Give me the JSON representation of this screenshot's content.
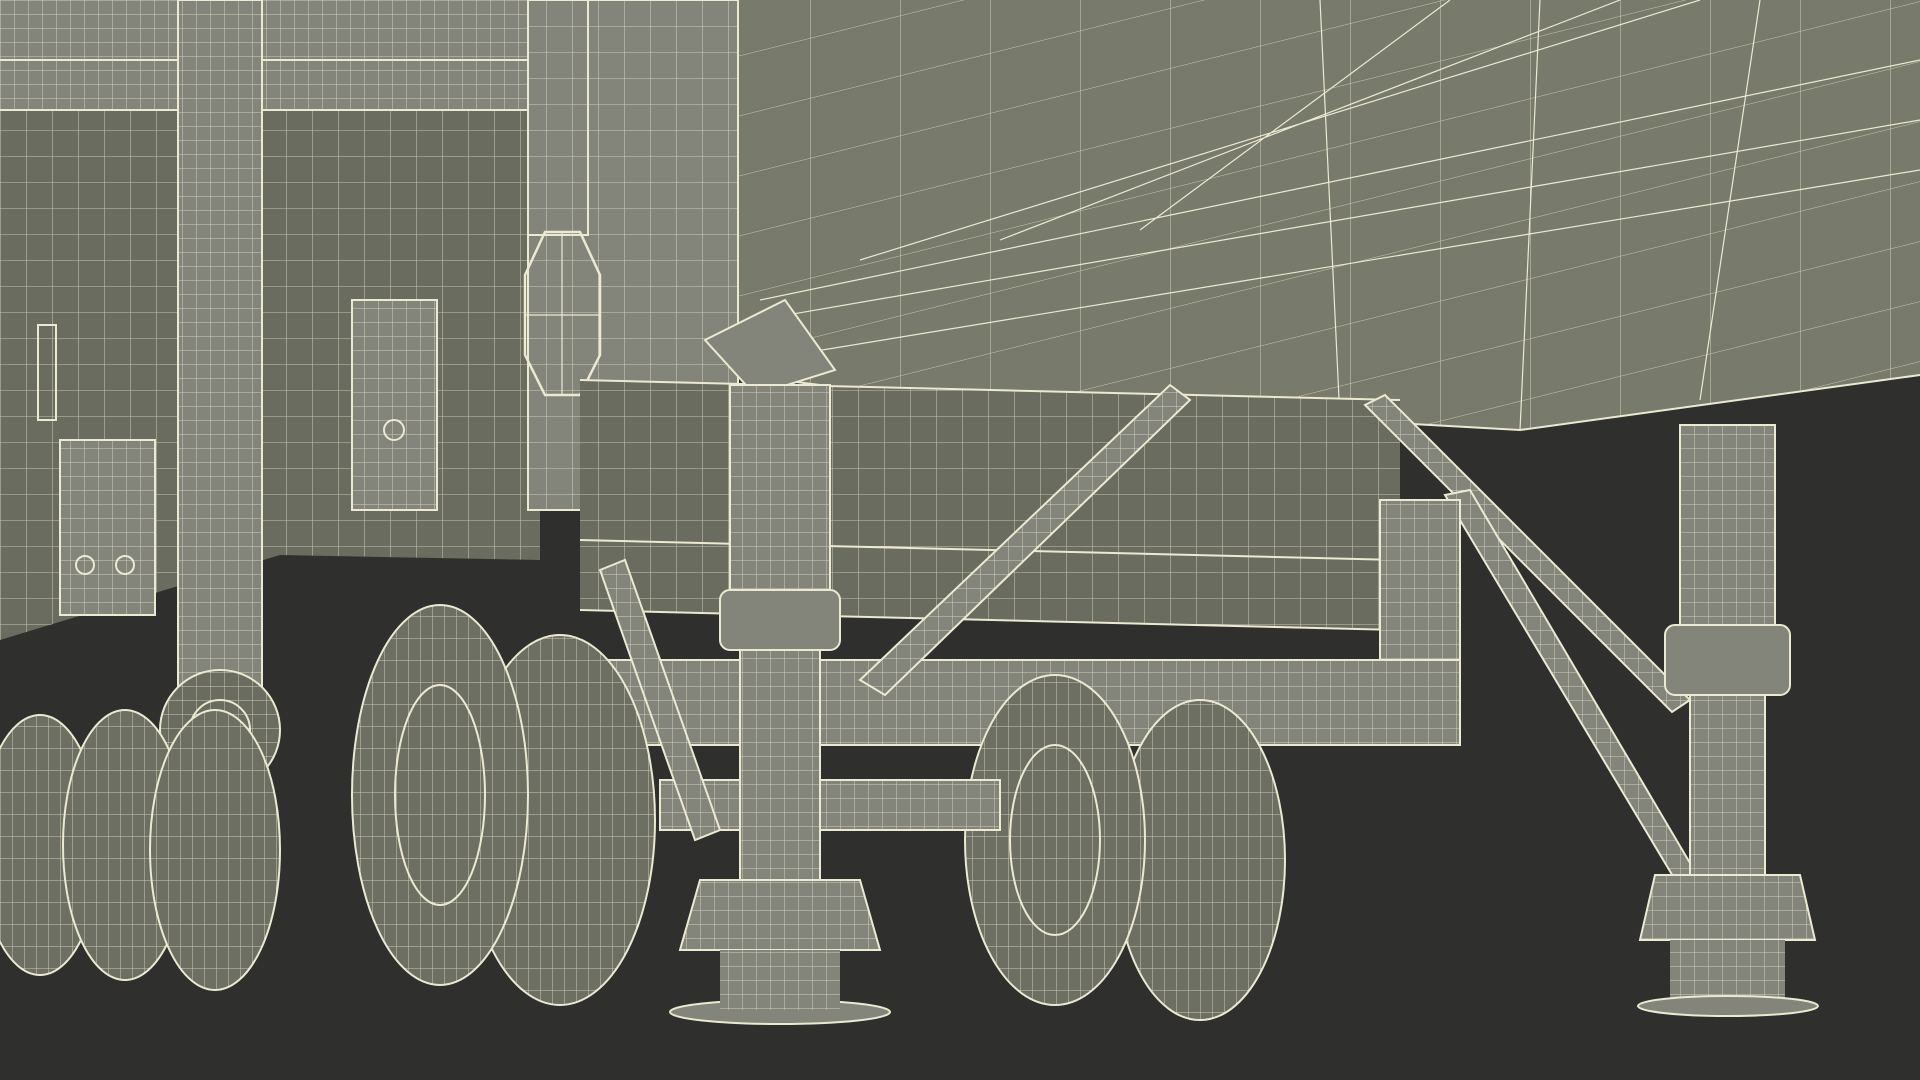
{
  "scene": {
    "subject": "wireframe-render-trailer-undercarriage",
    "colors": {
      "background": "#2f302d",
      "body": "#787a6b",
      "body_light": "#83857a",
      "body_shadow": "#6a6c5f",
      "tire": "#6d6f63",
      "wire": "#ece9d2"
    }
  }
}
